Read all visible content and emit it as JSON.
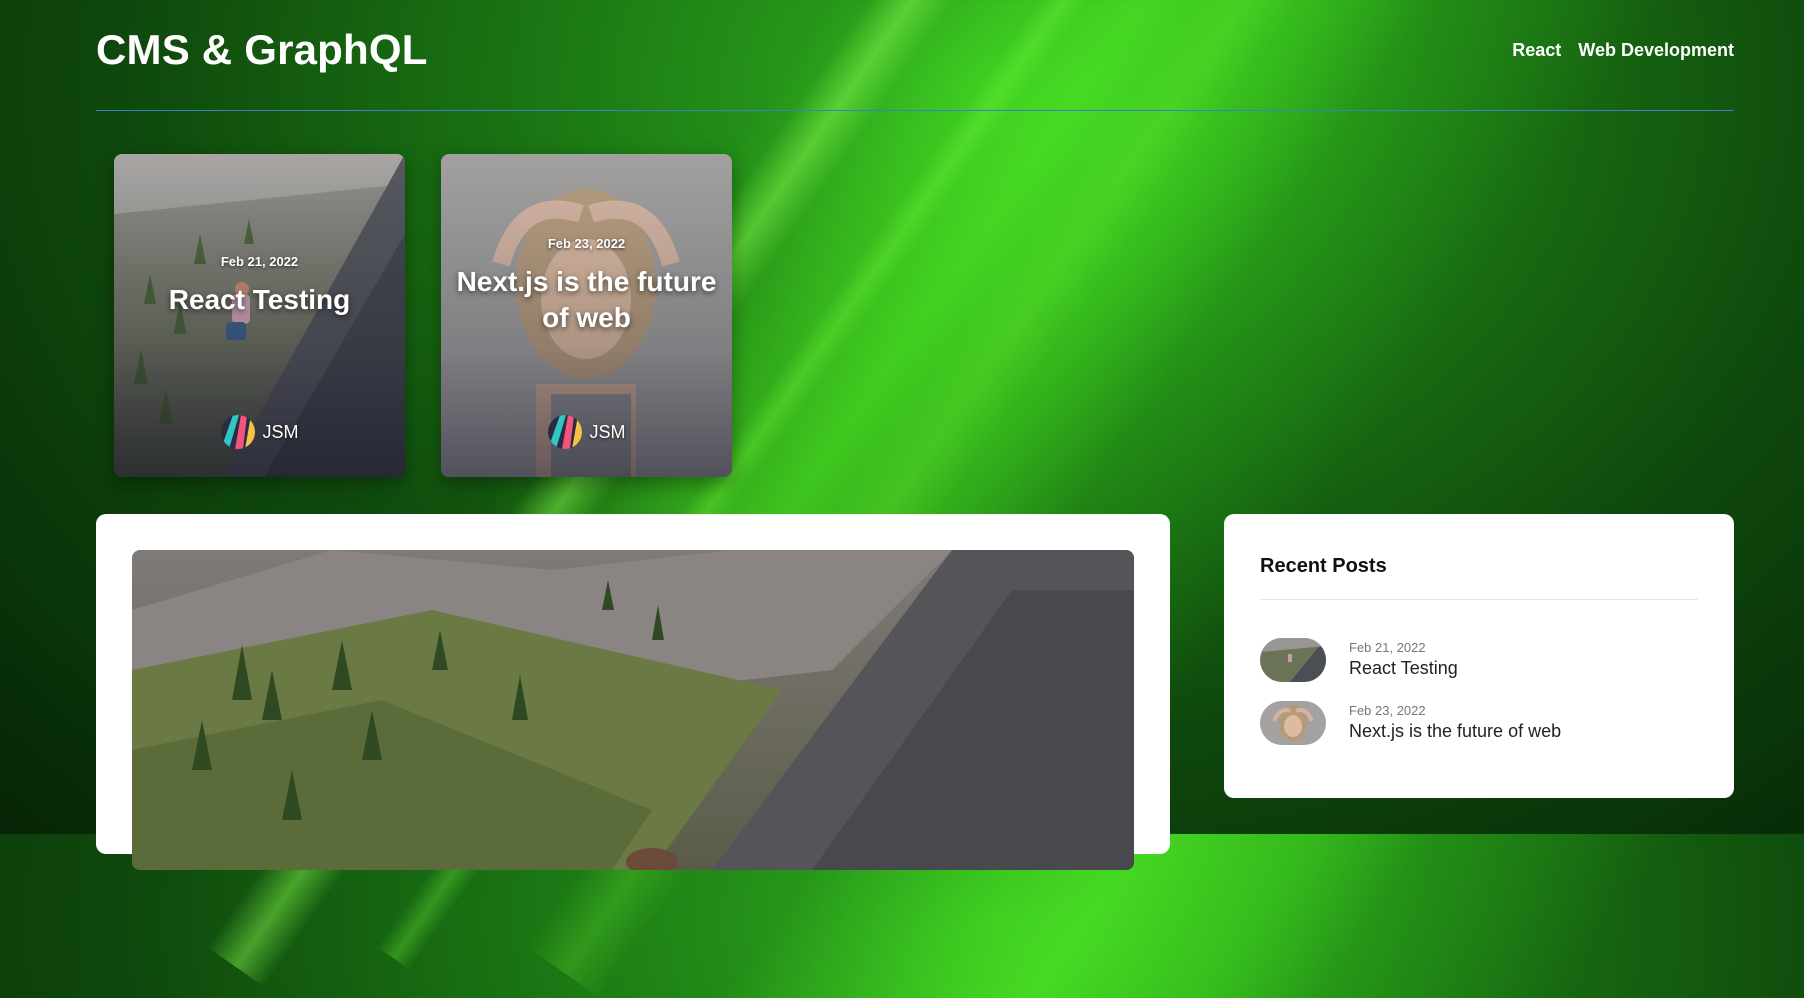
{
  "site": {
    "title": "CMS & GraphQL"
  },
  "nav": {
    "items": [
      "React",
      "Web Development"
    ]
  },
  "featured_posts": [
    {
      "date": "Feb 21, 2022",
      "title": "React Testing",
      "author": "JSM"
    },
    {
      "date": "Feb 23, 2022",
      "title": "Next.js is the future of web",
      "author": "JSM"
    }
  ],
  "sidebar": {
    "heading": "Recent Posts",
    "posts": [
      {
        "date": "Feb 21, 2022",
        "title": "React Testing"
      },
      {
        "date": "Feb 23, 2022",
        "title": "Next.js is the future of web"
      }
    ]
  },
  "colors": {
    "background": "#1c7a14",
    "divider": "#3b82c4",
    "card": "#ffffff"
  }
}
